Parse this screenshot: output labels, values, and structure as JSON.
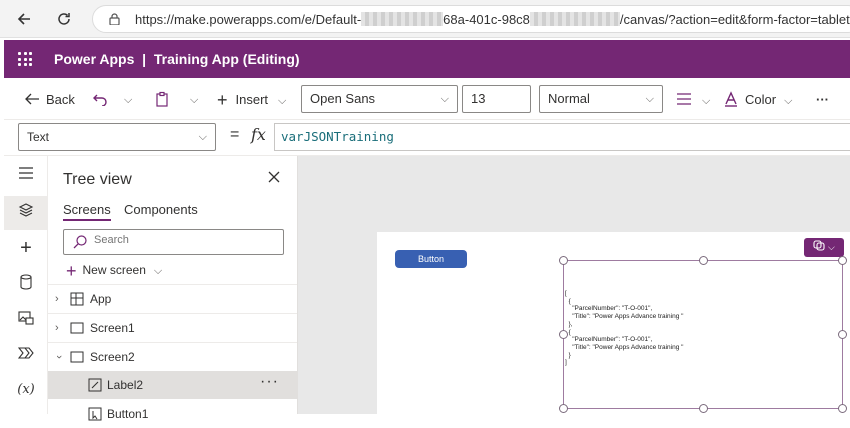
{
  "browser": {
    "url_prefix": "https://make.powerapps.com/e/Default-",
    "url_mid": "68a-401c-98c8",
    "url_suffix": "/canvas/?action=edit&form-factor=tablet&nam"
  },
  "app": {
    "title": "Power Apps  |  Training App (Editing)"
  },
  "toolbar": {
    "back_label": "Back",
    "insert_label": "Insert",
    "font_family": "Open Sans",
    "font_size": "13",
    "font_weight": "Normal",
    "color_label": "Color",
    "more_label": "···"
  },
  "formula_bar": {
    "property": "Text",
    "equals": "=",
    "fx": "fx",
    "formula": "varJSONTraining"
  },
  "tree_view": {
    "title": "Tree view",
    "tabs": [
      "Screens",
      "Components"
    ],
    "search_placeholder": "Search",
    "new_screen_label": "New screen",
    "items": [
      {
        "label": "App",
        "type": "app"
      },
      {
        "label": "Screen1",
        "type": "screen"
      },
      {
        "label": "Screen2",
        "type": "screen",
        "expanded": true
      },
      {
        "label": "Label2",
        "type": "label",
        "selected": true
      },
      {
        "label": "Button1",
        "type": "button"
      }
    ],
    "more_label": "···"
  },
  "canvas": {
    "button_label": "Button",
    "label_text": "[\n  {\n    \"ParcelNumber\": \"T-O-001\",\n    \"Title\": \"Power Apps Advance training \"\n  },\n  {\n    \"ParcelNumber\": \"T-O-001\",\n    \"Title\": \"Power Apps Advance training \"\n  }\n]"
  },
  "colors": {
    "brand": "#742774",
    "button": "#3860b2"
  }
}
